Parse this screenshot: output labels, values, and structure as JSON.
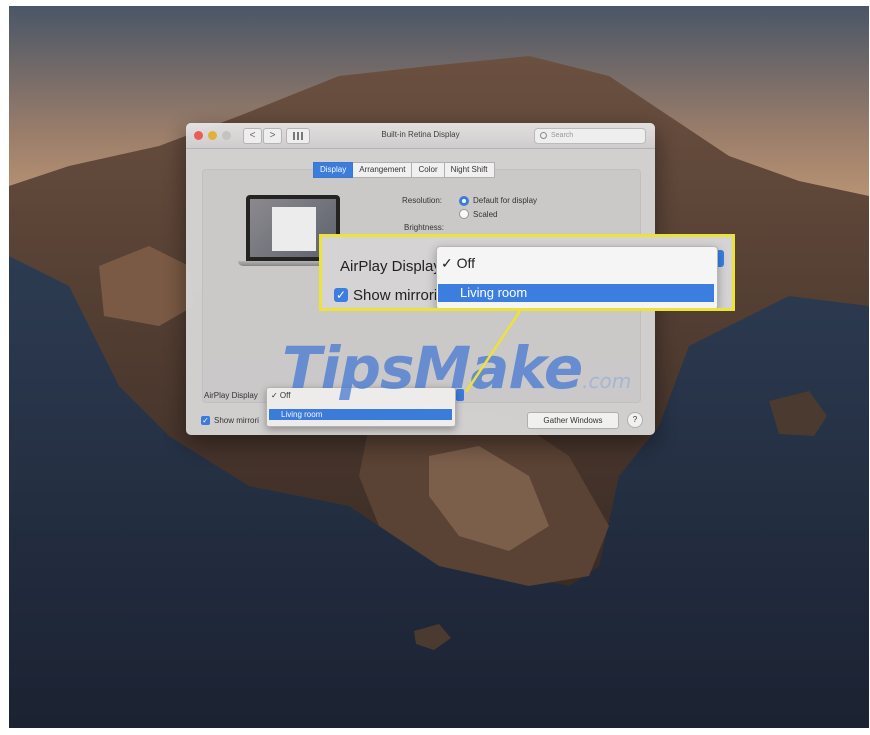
{
  "window": {
    "title": "Built-in Retina Display",
    "search_placeholder": "Search",
    "back_label": "<",
    "forward_label": ">"
  },
  "tabs": [
    {
      "label": "Display",
      "active": true
    },
    {
      "label": "Arrangement",
      "active": false
    },
    {
      "label": "Color",
      "active": false
    },
    {
      "label": "Night Shift",
      "active": false
    }
  ],
  "display": {
    "resolution_label": "Resolution:",
    "option_default": "Default for display",
    "option_scaled": "Scaled",
    "brightness_label": "Brightness:"
  },
  "footer": {
    "airplay_label": "AirPlay Display",
    "mirroring_label": "Show mirrori",
    "gather_windows": "Gather Windows",
    "help": "?"
  },
  "airplay_menu": {
    "off": "✓ Off",
    "living_room": "Living room"
  },
  "callout": {
    "airplay_label": "AirPlay Display",
    "mirroring_label": "Show mirrori",
    "off": "✓ Off",
    "living_room": "Living room"
  },
  "watermark": {
    "text": "TipsMake",
    "suffix": ".com"
  },
  "colors": {
    "accent": "#3b7ee0",
    "callout_border": "#ece33a",
    "close": "#ee5e55",
    "minimize": "#e7b53a"
  }
}
